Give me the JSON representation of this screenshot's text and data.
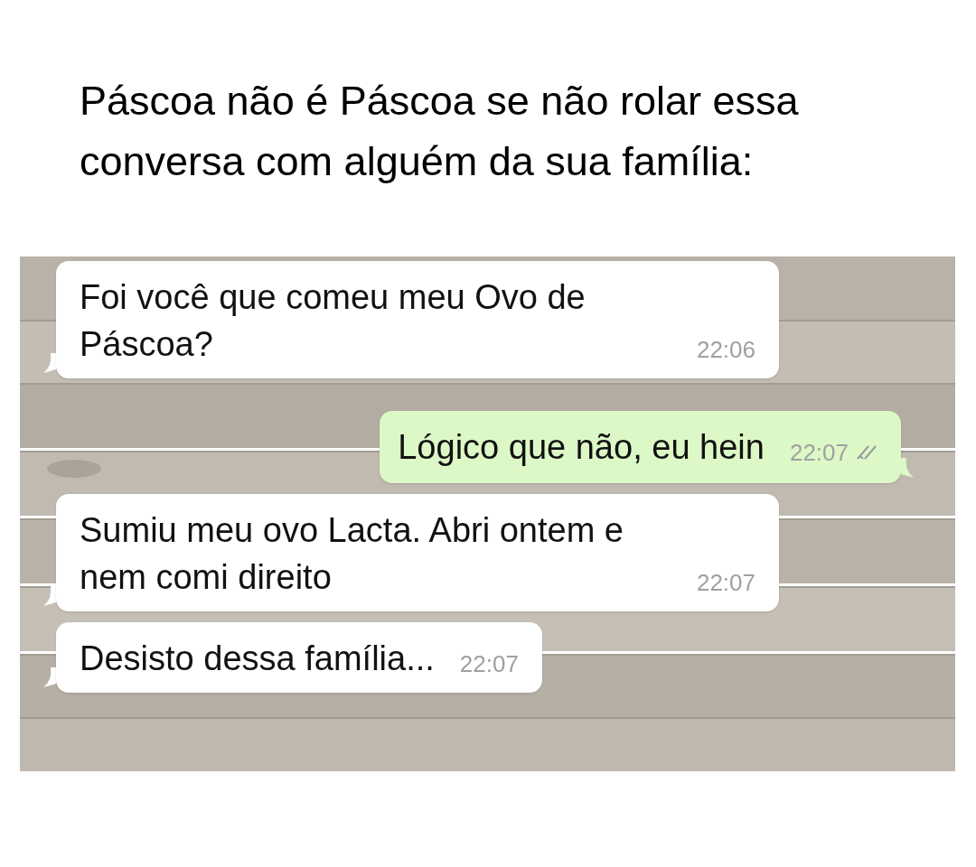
{
  "caption": "Páscoa não é Páscoa se não rolar essa conversa com alguém da sua família:",
  "messages": [
    {
      "kind": "received",
      "text": "Foi você que comeu meu Ovo de Páscoa?",
      "time": "22:06"
    },
    {
      "kind": "sent",
      "text": "Lógico que não, eu hein",
      "time": "22:07",
      "read": false
    },
    {
      "kind": "received",
      "text": "Sumiu meu ovo Lacta. Abri ontem e nem comi direito",
      "time": "22:07"
    },
    {
      "kind": "received",
      "text": "Desisto dessa família...",
      "time": "22:07"
    }
  ]
}
